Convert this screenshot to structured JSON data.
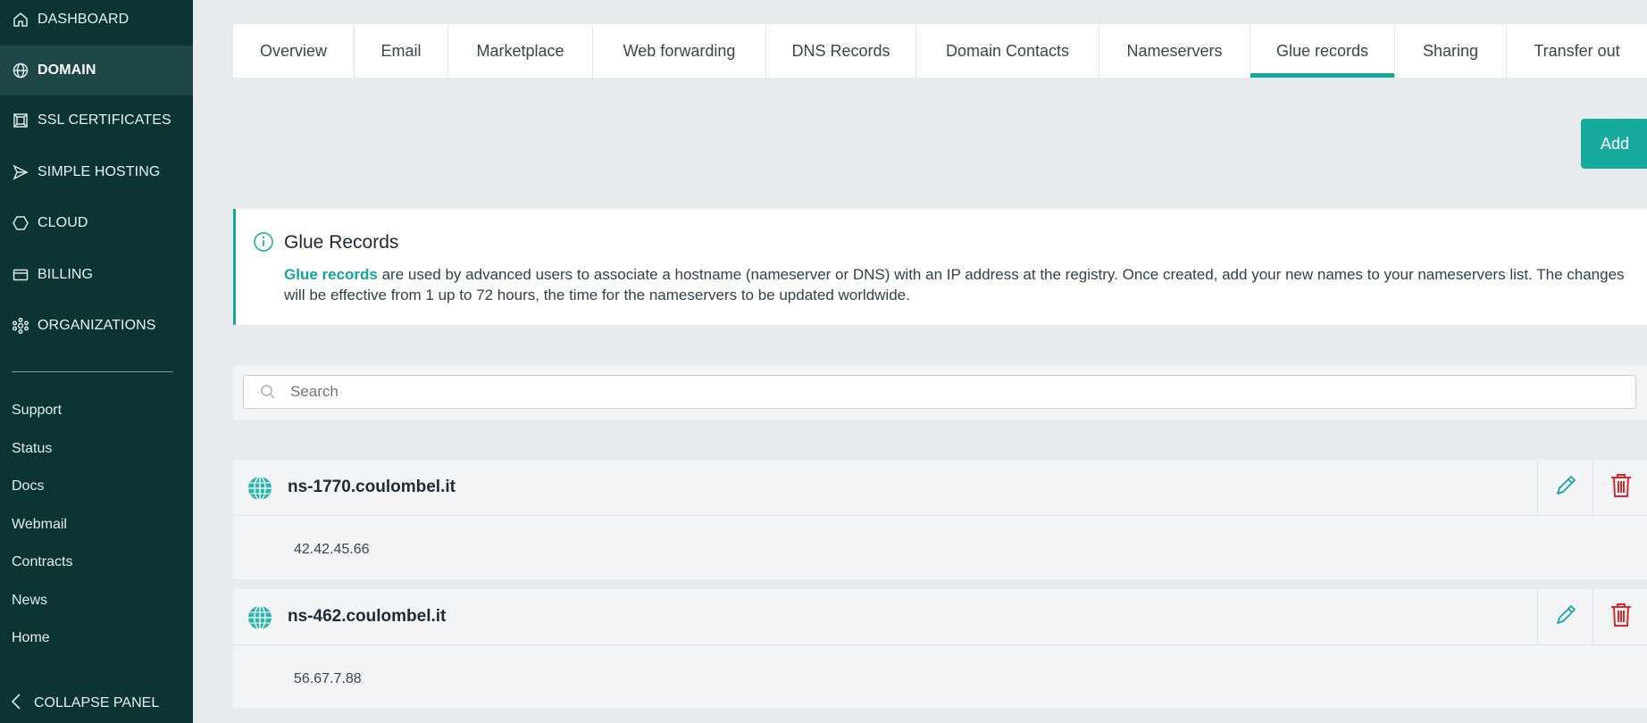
{
  "sidebar": {
    "nav": [
      {
        "label": "DASHBOARD",
        "icon": "home-icon"
      },
      {
        "label": "DOMAIN",
        "icon": "globe-icon",
        "active": true
      },
      {
        "label": "SSL CERTIFICATES",
        "icon": "certificate-icon"
      },
      {
        "label": "SIMPLE HOSTING",
        "icon": "send-icon"
      },
      {
        "label": "CLOUD",
        "icon": "cube-icon"
      },
      {
        "label": "BILLING",
        "icon": "card-icon"
      },
      {
        "label": "ORGANIZATIONS",
        "icon": "organization-icon"
      }
    ],
    "links": [
      "Support",
      "Status",
      "Docs",
      "Webmail",
      "Contracts",
      "News",
      "Home"
    ],
    "collapse_label": "COLLAPSE PANEL"
  },
  "tabs": [
    {
      "label": "Overview"
    },
    {
      "label": "Email"
    },
    {
      "label": "Marketplace"
    },
    {
      "label": "Web forwarding"
    },
    {
      "label": "DNS Records"
    },
    {
      "label": "Domain Contacts"
    },
    {
      "label": "Nameservers"
    },
    {
      "label": "Glue records",
      "active": true
    },
    {
      "label": "Sharing"
    },
    {
      "label": "Transfer out"
    }
  ],
  "add_label": "Add",
  "info": {
    "title": "Glue Records",
    "highlight": "Glue records",
    "text": " are used by advanced users to associate a hostname (nameserver or DNS) with an IP address at the registry. Once created, add your new names to your nameservers list. The changes will be effective from 1 up to 72 hours, the time for the nameservers to be updated worldwide."
  },
  "search": {
    "placeholder": "Search"
  },
  "records": [
    {
      "name": "ns-1770.coulombel.it",
      "ip": "42.42.45.66"
    },
    {
      "name": "ns-462.coulombel.it",
      "ip": "56.67.7.88"
    }
  ],
  "colors": {
    "accent": "#14a8a1",
    "sidebar": "#0b3433",
    "delete": "#d42a2a"
  }
}
